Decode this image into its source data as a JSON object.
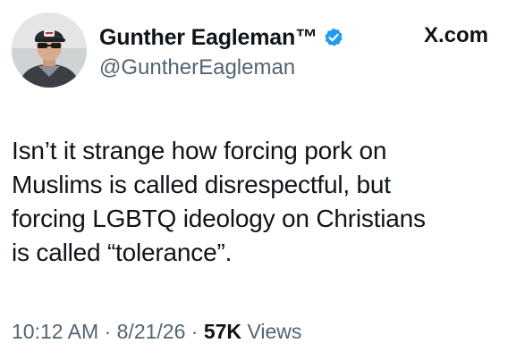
{
  "author": {
    "display_name": "Gunther Eagleman™",
    "handle": "@GuntherEagleman",
    "verified": true,
    "verified_color": "#1d9bf0",
    "avatar_icon": "profile-photo-man-in-cap-and-sunglasses"
  },
  "source_label": "X.com",
  "tweet": {
    "lines": [
      "Isn’t it strange how forcing pork on",
      "Muslims is called disrespectful, but",
      "forcing LGBTQ ideology on Christians",
      "is called “tolerance”."
    ]
  },
  "meta": {
    "time": "10:12 AM",
    "date": "8/21/26",
    "separator": "·",
    "views_count": "57K",
    "views_label": "Views"
  },
  "colors": {
    "text_primary": "#0f1419",
    "text_secondary": "#536471",
    "background": "#ffffff"
  }
}
